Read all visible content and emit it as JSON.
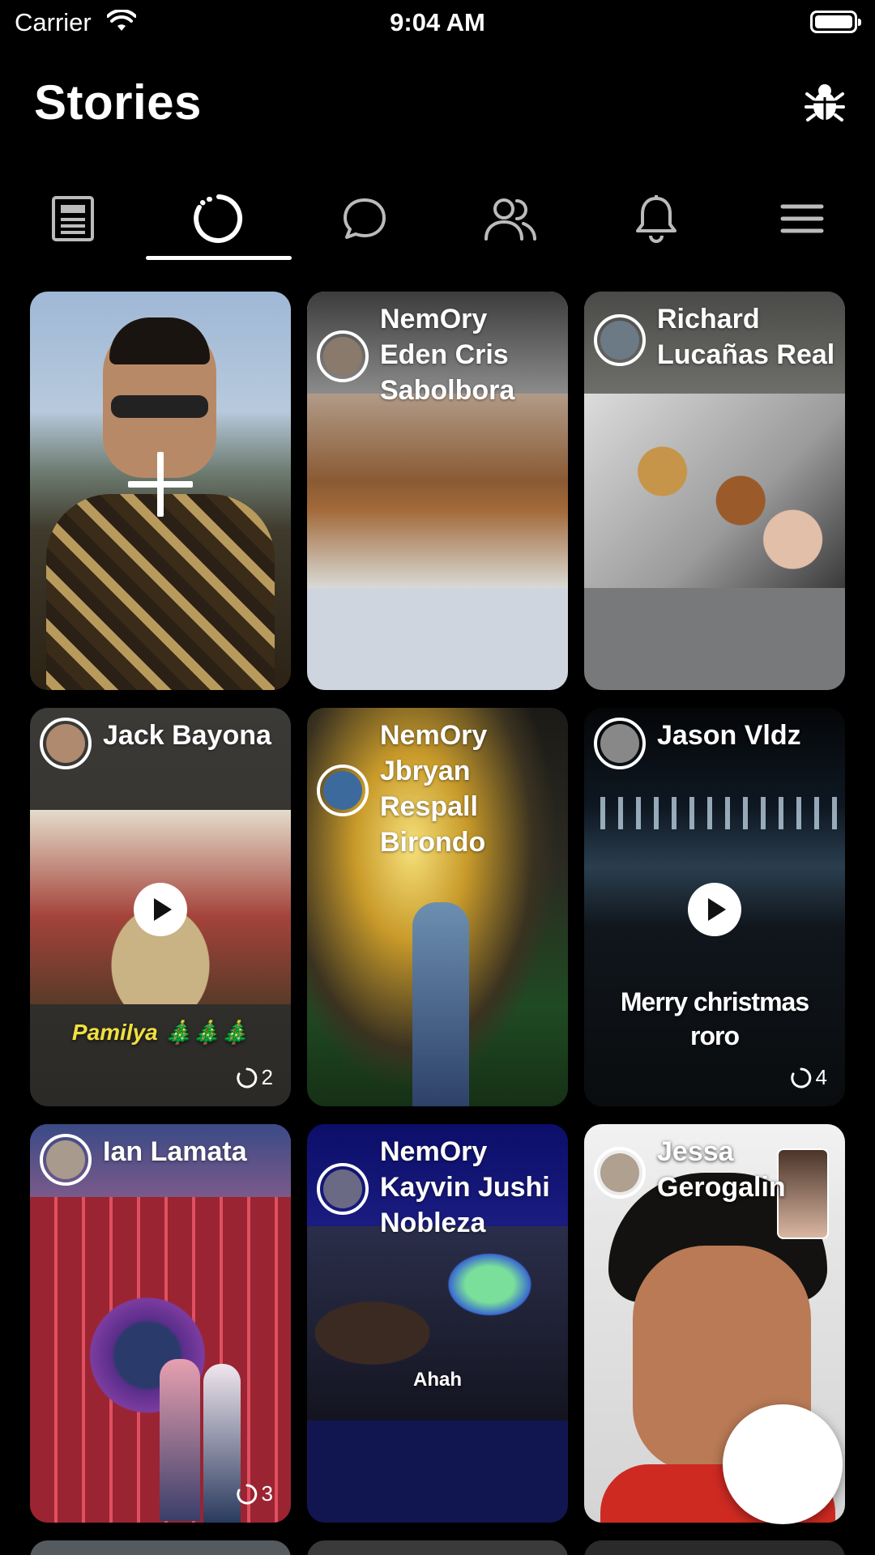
{
  "status_bar": {
    "carrier": "Carrier",
    "time": "9:04 AM"
  },
  "header": {
    "title": "Stories",
    "bug_icon": "bug-icon"
  },
  "tabs": [
    {
      "icon": "news-feed-icon",
      "active": false
    },
    {
      "icon": "stories-icon",
      "active": true
    },
    {
      "icon": "chat-bubble-icon",
      "active": false
    },
    {
      "icon": "friends-icon",
      "active": false
    },
    {
      "icon": "bell-icon",
      "active": false
    },
    {
      "icon": "menu-icon",
      "active": false
    }
  ],
  "stories": [
    {
      "type": "create",
      "icon": "plus-icon"
    },
    {
      "name": "NemOry Eden Cris Sabolbora"
    },
    {
      "name": "Richard Lucañas Real"
    },
    {
      "name": "Jack Bayona",
      "video": true,
      "caption": "Pamilya 🎄🎄🎄",
      "count": "2"
    },
    {
      "name": "NemOry Jbryan Respall Birondo"
    },
    {
      "name": "Jason Vldz",
      "video": true,
      "caption": "Merry christmas roro",
      "count": "4"
    },
    {
      "name": "Ian Lamata",
      "count": "3"
    },
    {
      "name": "NemOry Kayvin Jushi Nobleza",
      "caption": "Ahah"
    },
    {
      "name": "Jessa Gerogalin"
    }
  ],
  "colors": {
    "background": "#000000",
    "accent": "#ffffff"
  }
}
